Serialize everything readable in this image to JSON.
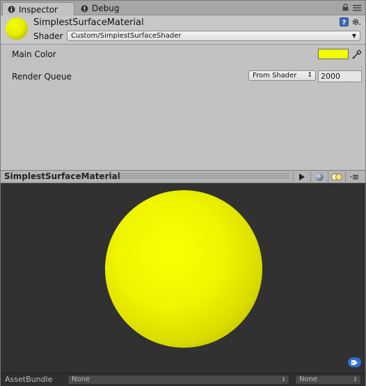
{
  "tabs": [
    {
      "label": "Inspector",
      "icon": "info-icon"
    },
    {
      "label": "Debug",
      "icon": "bug-icon"
    }
  ],
  "material": {
    "name": "SimplestSurfaceMaterial",
    "shader_label": "Shader",
    "shader_value": "Custom/SimplestSurfaceShader"
  },
  "properties": {
    "main_color_label": "Main Color",
    "main_color_value": "#F2FF00",
    "render_queue_label": "Render Queue",
    "render_queue_mode": "From Shader",
    "render_queue_value": "2000"
  },
  "preview": {
    "title": "SimplestSurfaceMaterial"
  },
  "asset_bundle": {
    "label": "AssetBundle",
    "name_value": "None",
    "variant_value": "None"
  },
  "colors": {
    "sphere": "#F0F600",
    "tag_badge": "#2D6FD8"
  }
}
